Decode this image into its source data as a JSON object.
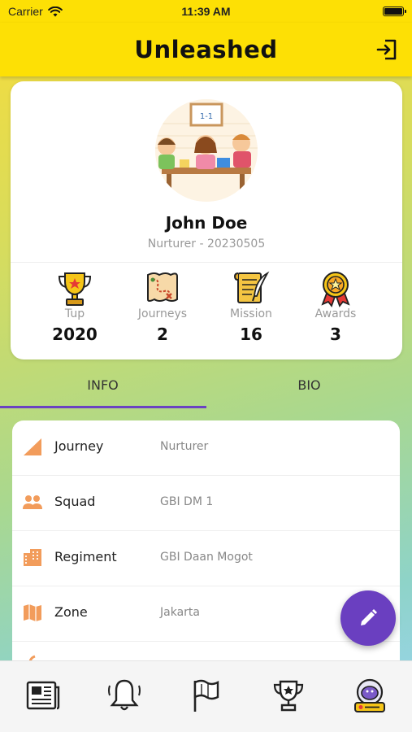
{
  "status_bar": {
    "carrier": "Carrier",
    "time": "11:39 AM"
  },
  "app_bar": {
    "title": "Unleashed",
    "logout_icon": "logout-icon"
  },
  "profile": {
    "name": "John Doe",
    "subtitle": "Nurturer - 20230505",
    "avatar_board_text": "1-1",
    "stats": [
      {
        "label": "Tup",
        "value": "2020",
        "icon": "trophy-icon"
      },
      {
        "label": "Journeys",
        "value": "2",
        "icon": "treasure-map-icon"
      },
      {
        "label": "Mission",
        "value": "16",
        "icon": "scroll-quill-icon"
      },
      {
        "label": "Awards",
        "value": "3",
        "icon": "medal-icon"
      }
    ]
  },
  "tabs": [
    {
      "label": "INFO",
      "active": true
    },
    {
      "label": "BIO",
      "active": false
    }
  ],
  "info_rows": [
    {
      "label": "Journey",
      "value": "Nurturer",
      "icon": "triangle-icon"
    },
    {
      "label": "Squad",
      "value": "GBI DM 1",
      "icon": "people-icon"
    },
    {
      "label": "Regiment",
      "value": "GBI Daan Mogot",
      "icon": "buildings-icon"
    },
    {
      "label": "Zone",
      "value": "Jakarta",
      "icon": "map-icon"
    }
  ],
  "fab": {
    "icon": "pencil-icon"
  },
  "bottom_nav": [
    {
      "icon": "newspaper-icon",
      "active": false
    },
    {
      "icon": "bell-icon",
      "active": false
    },
    {
      "icon": "flag-icon",
      "active": false
    },
    {
      "icon": "trophy-outline-icon",
      "active": false
    },
    {
      "icon": "astronaut-profile-icon",
      "active": true
    }
  ],
  "colors": {
    "app_bar": "#fde005",
    "accent_purple": "#6a42c2",
    "info_icon_orange": "#f29c5b"
  }
}
